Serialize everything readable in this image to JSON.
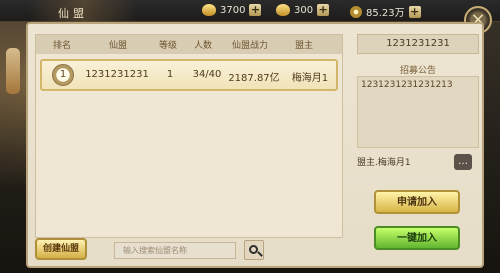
{
  "title": "仙盟",
  "currencies": [
    {
      "name": "jade",
      "value": "3700"
    },
    {
      "name": "silver",
      "value": "300"
    },
    {
      "name": "gold",
      "value": "85.23万"
    }
  ],
  "table": {
    "headers": [
      "排名",
      "仙盟",
      "等级",
      "人数",
      "仙盟战力",
      "盟主"
    ],
    "rows": [
      {
        "rank": "1",
        "name": "1231231231",
        "level": "1",
        "members": "34/40",
        "power": "2187.87亿",
        "leader": "梅海月1"
      }
    ]
  },
  "right_panel": {
    "guild_id": "1231231231",
    "notice_title": "招募公告",
    "notice_text": "1231231231231213",
    "leader_text": "盟主.梅海月1",
    "apply_label": "申请加入",
    "quick_join_label": "一键加入"
  },
  "bottom": {
    "create_label": "创建仙盟",
    "search_placeholder": "输入搜索仙盟名称"
  }
}
